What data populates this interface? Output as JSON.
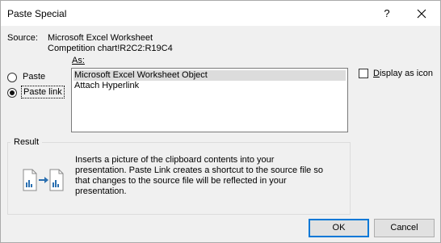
{
  "window": {
    "title": "Paste Special",
    "help_glyph": "?",
    "close_glyph": "✕"
  },
  "source": {
    "label": "Source:",
    "name": "Microsoft Excel Worksheet",
    "range": "Competition chart!R2C2:R19C4"
  },
  "paste_options": {
    "as_label": "As:",
    "paste_label": "Paste",
    "paste_link_label": "Paste link",
    "selected": "Paste link"
  },
  "as_list": {
    "items": [
      "Microsoft Excel Worksheet Object",
      "Attach Hyperlink"
    ],
    "selected_index": 0
  },
  "display_as_icon": {
    "label_underlined": "D",
    "label_rest": "isplay as icon",
    "checked": false
  },
  "result": {
    "legend": "Result",
    "icon": "paste-link-result-icon",
    "lines": [
      "Inserts a picture of the clipboard contents into your",
      "presentation. Paste Link creates a shortcut to the source file so",
      "that changes to the source file will be reflected in your",
      "presentation."
    ]
  },
  "buttons": {
    "ok_label": "OK",
    "cancel_label": "Cancel"
  },
  "colors": {
    "dialog_bg": "#f0f0f0",
    "titlebar_bg": "#ffffff",
    "default_button_border": "#0078d7",
    "list_selection": "#dcdcdc",
    "icon_accent": "#2a6fb0"
  }
}
